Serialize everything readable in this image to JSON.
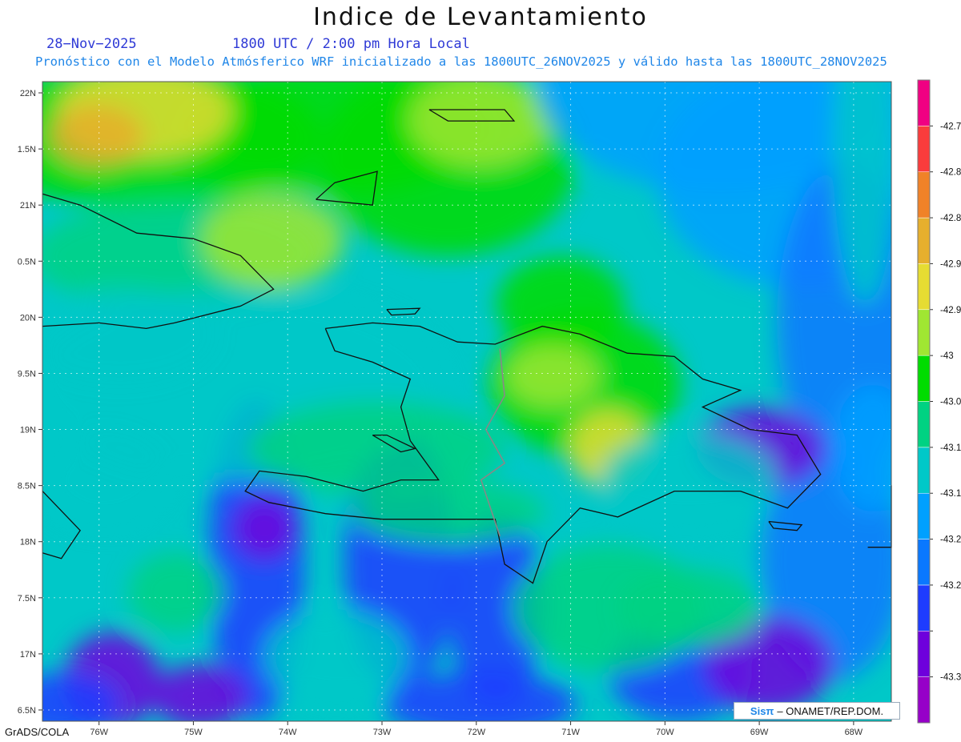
{
  "title": "Indice de Levantamiento",
  "date_label": "28−Nov−2025",
  "time_label": "1800 UTC / 2:00 pm Hora Local",
  "description": "Pronóstico con el Modelo Atmósferico WRF inicializado a las 1800UTC_26NOV2025 y válido hasta las  1800UTC_28NOV2025",
  "footer": "GrADS/COLA",
  "credit": {
    "logo_text": "Sisπ",
    "text": "– ONAMET/REP.DOM."
  },
  "map": {
    "lon_range": [
      -76.6,
      -67.6
    ],
    "lat_range": [
      16.4,
      22.1
    ],
    "lat_ticks": [
      {
        "value": 22,
        "label": "22N"
      },
      {
        "value": 21.5,
        "label": "1.5N"
      },
      {
        "value": 21,
        "label": "21N"
      },
      {
        "value": 20.5,
        "label": "0.5N"
      },
      {
        "value": 20,
        "label": "20N"
      },
      {
        "value": 19.5,
        "label": "9.5N"
      },
      {
        "value": 19,
        "label": "19N"
      },
      {
        "value": 18.5,
        "label": "8.5N"
      },
      {
        "value": 18,
        "label": "18N"
      },
      {
        "value": 17.5,
        "label": "7.5N"
      },
      {
        "value": 17,
        "label": "17N"
      },
      {
        "value": 16.5,
        "label": "6.5N"
      }
    ],
    "lon_ticks": [
      {
        "value": -76,
        "label": "76W"
      },
      {
        "value": -75,
        "label": "75W"
      },
      {
        "value": -74,
        "label": "74W"
      },
      {
        "value": -73,
        "label": "73W"
      },
      {
        "value": -72,
        "label": "72W"
      },
      {
        "value": -71,
        "label": "71W"
      },
      {
        "value": -70,
        "label": "70W"
      },
      {
        "value": -69,
        "label": "69W"
      },
      {
        "value": -68,
        "label": "68W"
      }
    ],
    "colorbar": [
      {
        "color": "#9600c8",
        "label": "-43.3"
      },
      {
        "color": "#6e00dc",
        "label": ""
      },
      {
        "color": "#1e3cff",
        "label": "-43.2"
      },
      {
        "color": "#0a78ff",
        "label": "-43.2"
      },
      {
        "color": "#00a0ff",
        "label": "-43.1"
      },
      {
        "color": "#00c8c8",
        "label": "-43.1"
      },
      {
        "color": "#00d282",
        "label": "-43.0"
      },
      {
        "color": "#00dc00",
        "label": "-43"
      },
      {
        "color": "#a0e632",
        "label": "-42.9"
      },
      {
        "color": "#e6dc32",
        "label": "-42.9"
      },
      {
        "color": "#e6af2d",
        "label": "-42.8"
      },
      {
        "color": "#f08228",
        "label": "-42.8"
      },
      {
        "color": "#fa3c3c",
        "label": "-42.7"
      },
      {
        "color": "#f00082",
        "label": ""
      }
    ]
  }
}
